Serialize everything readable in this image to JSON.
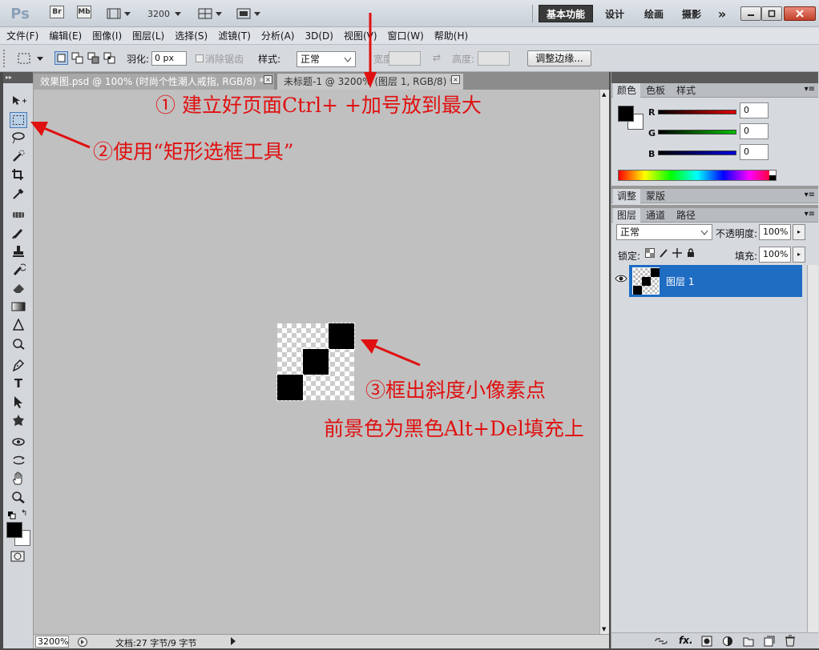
{
  "titlebar": {
    "logo": "Ps",
    "bridge": "Br",
    "minibridge": "Mb",
    "zoom": "3200",
    "workspaces": [
      "基本功能",
      "设计",
      "绘画",
      "摄影"
    ],
    "more": "»"
  },
  "menu": [
    "文件(F)",
    "编辑(E)",
    "图像(I)",
    "图层(L)",
    "选择(S)",
    "滤镜(T)",
    "分析(A)",
    "3D(D)",
    "视图(V)",
    "窗口(W)",
    "帮助(H)"
  ],
  "options": {
    "feather_label": "羽化:",
    "feather_value": "0 px",
    "antialias_label": "消除锯齿",
    "style_label": "样式:",
    "style_value": "正常",
    "width_label": "宽度:",
    "height_label": "高度:",
    "refine_edge": "调整边缘..."
  },
  "documents": {
    "tabs": [
      {
        "label": "效果图.psd @ 100% (时尚个性潮人戒指, RGB/8) *",
        "active": false
      },
      {
        "label": "未标题-1 @ 3200% (图层 1, RGB/8) *",
        "active": true
      }
    ],
    "close": "×"
  },
  "status": {
    "zoom": "3200%",
    "info": "文档:27 字节/9 字节"
  },
  "color_panel": {
    "tabs": [
      "颜色",
      "色板",
      "样式"
    ],
    "channels": [
      {
        "label": "R",
        "value": "0",
        "color": "#e00000"
      },
      {
        "label": "G",
        "value": "0",
        "color": "#00c000"
      },
      {
        "label": "B",
        "value": "0",
        "color": "#0000e0"
      }
    ]
  },
  "adjust_panel": {
    "tabs": [
      "调整",
      "蒙版"
    ]
  },
  "layers_panel": {
    "tabs": [
      "图层",
      "通道",
      "路径"
    ],
    "blend_mode": "正常",
    "opacity_label": "不透明度:",
    "opacity_value": "100%",
    "lock_label": "锁定:",
    "fill_label": "填充:",
    "fill_value": "100%",
    "layers": [
      {
        "name": "图层 1",
        "selected": true
      }
    ],
    "footer_fx": "fx."
  },
  "annotations": {
    "step1": "① 建立好页面Ctrl+  +加号放到最大",
    "step2": "②使用“矩形选框工具”",
    "step3": "③框出斜度小像素点",
    "step3b": "前景色为黑色Alt+Del填充上"
  },
  "colors": {
    "annotation": "#e01010",
    "selection_highlight": "#1f6cc3"
  }
}
